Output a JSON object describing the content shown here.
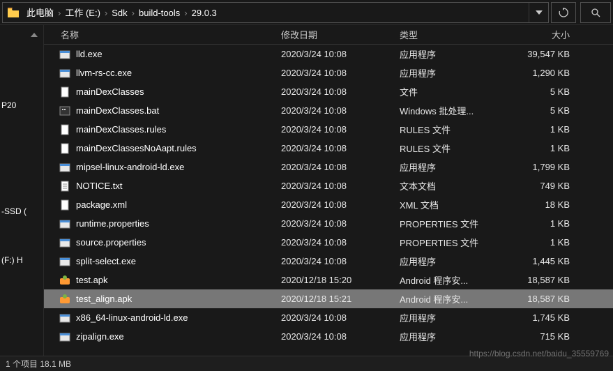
{
  "breadcrumb": [
    {
      "label": "此电脑"
    },
    {
      "label": "工作 (E:)"
    },
    {
      "label": "Sdk"
    },
    {
      "label": "build-tools"
    },
    {
      "label": "29.0.3"
    }
  ],
  "nav_items": [
    "P20",
    "-SSD (",
    "(F:) H"
  ],
  "headers": {
    "name": "名称",
    "date": "修改日期",
    "type": "类型",
    "size": "大小"
  },
  "files": [
    {
      "icon": "exe",
      "name": "lld.exe",
      "date": "2020/3/24 10:08",
      "type": "应用程序",
      "size": "39,547 KB",
      "sel": false
    },
    {
      "icon": "exe",
      "name": "llvm-rs-cc.exe",
      "date": "2020/3/24 10:08",
      "type": "应用程序",
      "size": "1,290 KB",
      "sel": false
    },
    {
      "icon": "file",
      "name": "mainDexClasses",
      "date": "2020/3/24 10:08",
      "type": "文件",
      "size": "5 KB",
      "sel": false
    },
    {
      "icon": "bat",
      "name": "mainDexClasses.bat",
      "date": "2020/3/24 10:08",
      "type": "Windows 批处理...",
      "size": "5 KB",
      "sel": false
    },
    {
      "icon": "file",
      "name": "mainDexClasses.rules",
      "date": "2020/3/24 10:08",
      "type": "RULES 文件",
      "size": "1 KB",
      "sel": false
    },
    {
      "icon": "file",
      "name": "mainDexClassesNoAapt.rules",
      "date": "2020/3/24 10:08",
      "type": "RULES 文件",
      "size": "1 KB",
      "sel": false
    },
    {
      "icon": "exe",
      "name": "mipsel-linux-android-ld.exe",
      "date": "2020/3/24 10:08",
      "type": "应用程序",
      "size": "1,799 KB",
      "sel": false
    },
    {
      "icon": "txt",
      "name": "NOTICE.txt",
      "date": "2020/3/24 10:08",
      "type": "文本文档",
      "size": "749 KB",
      "sel": false
    },
    {
      "icon": "file",
      "name": "package.xml",
      "date": "2020/3/24 10:08",
      "type": "XML 文档",
      "size": "18 KB",
      "sel": false
    },
    {
      "icon": "exe",
      "name": "runtime.properties",
      "date": "2020/3/24 10:08",
      "type": "PROPERTIES 文件",
      "size": "1 KB",
      "sel": false
    },
    {
      "icon": "exe",
      "name": "source.properties",
      "date": "2020/3/24 10:08",
      "type": "PROPERTIES 文件",
      "size": "1 KB",
      "sel": false
    },
    {
      "icon": "exe",
      "name": "split-select.exe",
      "date": "2020/3/24 10:08",
      "type": "应用程序",
      "size": "1,445 KB",
      "sel": false
    },
    {
      "icon": "apk",
      "name": "test.apk",
      "date": "2020/12/18 15:20",
      "type": "Android 程序安...",
      "size": "18,587 KB",
      "sel": false
    },
    {
      "icon": "apk",
      "name": "test_align.apk",
      "date": "2020/12/18 15:21",
      "type": "Android 程序安...",
      "size": "18,587 KB",
      "sel": true
    },
    {
      "icon": "exe",
      "name": "x86_64-linux-android-ld.exe",
      "date": "2020/3/24 10:08",
      "type": "应用程序",
      "size": "1,745 KB",
      "sel": false
    },
    {
      "icon": "exe",
      "name": "zipalign.exe",
      "date": "2020/3/24 10:08",
      "type": "应用程序",
      "size": "715 KB",
      "sel": false
    }
  ],
  "status": "1 个项目  18.1 MB",
  "watermark": "https://blog.csdn.net/baidu_35559769"
}
